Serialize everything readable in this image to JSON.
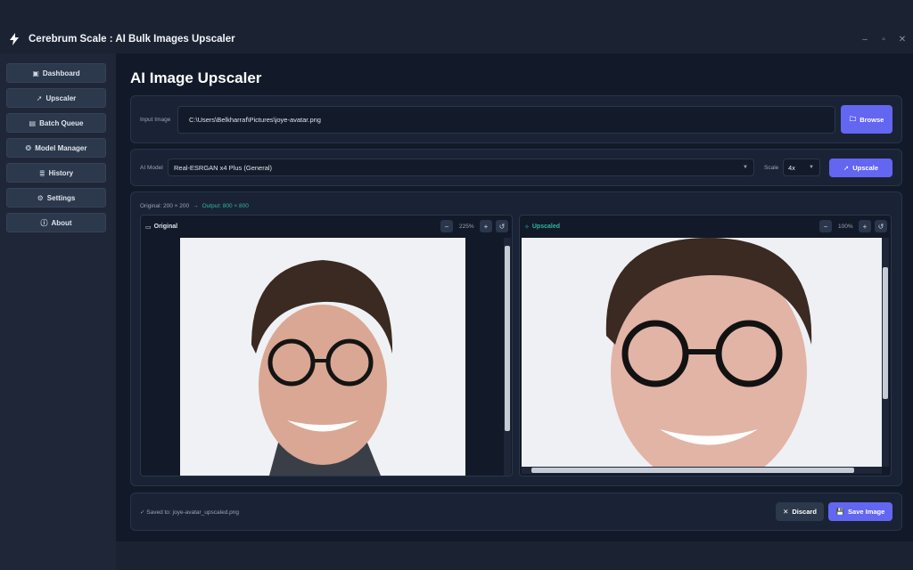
{
  "app": {
    "title": "Cerebrum Scale : AI Bulk Images Upscaler",
    "window_controls": [
      "–",
      "▫",
      "✕"
    ]
  },
  "sidebar": {
    "items": [
      {
        "label": "Dashboard",
        "icon": "dashboard-icon"
      },
      {
        "label": "Upscaler",
        "icon": "rocket-icon"
      },
      {
        "label": "Batch Queue",
        "icon": "queue-icon"
      },
      {
        "label": "Model Manager",
        "icon": "brain-icon"
      },
      {
        "label": "History",
        "icon": "scroll-icon"
      },
      {
        "label": "Settings",
        "icon": "gear-icon"
      },
      {
        "label": "About",
        "icon": "info-icon"
      }
    ]
  },
  "main": {
    "title": "AI Image Upscaler",
    "input": {
      "label": "Input Image",
      "value": "C:\\Users\\Belkharraf\\Pictures\\joye-avatar.png",
      "browse_label": "Browse"
    },
    "model": {
      "label": "AI Model",
      "value": "Real-ESRGAN x4 Plus (General)",
      "scale_label": "Scale",
      "scale_value": "4x",
      "upscale_label": "Upscale"
    },
    "compare": {
      "original_size": "Original: 200 × 200",
      "arrow": "→",
      "output_size": "Output: 800 × 800",
      "left": {
        "label": "Original",
        "zoom": "225%"
      },
      "right": {
        "label": "Upscaled",
        "zoom": "100%"
      }
    },
    "footer": {
      "status": "✓ Saved to: joye-avatar_upscaled.png",
      "discard_label": "Discard",
      "save_label": "Save Image"
    }
  },
  "colors": {
    "accent": "#6366f1",
    "success": "#2fb7a0",
    "background": "#121a29"
  }
}
